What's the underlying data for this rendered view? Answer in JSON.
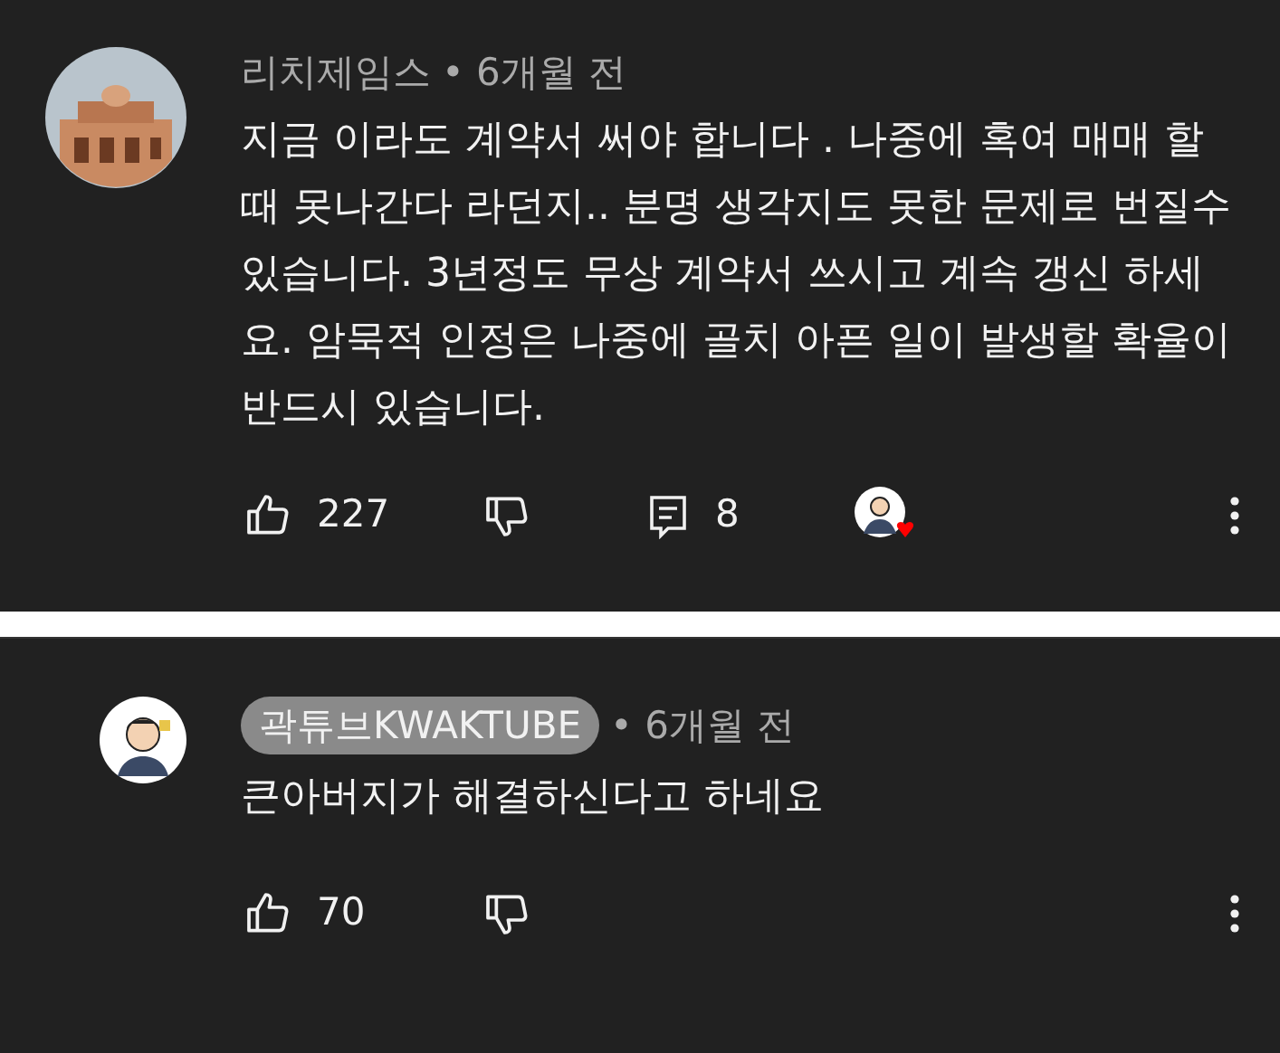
{
  "comments": [
    {
      "author": "리치제임스",
      "author_is_creator": false,
      "time": "• 6개월 전",
      "text": "지금 이라도 계약서 써야 합니다 . 나중에  혹여 매매 할때 못나간다 라던지.. 분명 생각지도 못한 문제로 번질수있습니다. 3년정도 무상 계약서 쓰시고 계속 갱신 하세요. 암묵적 인정은 나중에 골치 아픈 일이 발생할 확율이 반드시 있습니다.",
      "likes": "227",
      "replies": "8",
      "hearted": true,
      "avatar": {
        "kind": "building"
      }
    },
    {
      "author": "곽튜브KWAKTUBE",
      "author_is_creator": true,
      "time": "• 6개월 전",
      "text": "큰아버지가 해결하신다고 하네요",
      "likes": "70",
      "hearted": false,
      "avatar": {
        "kind": "cartoon"
      }
    }
  ]
}
